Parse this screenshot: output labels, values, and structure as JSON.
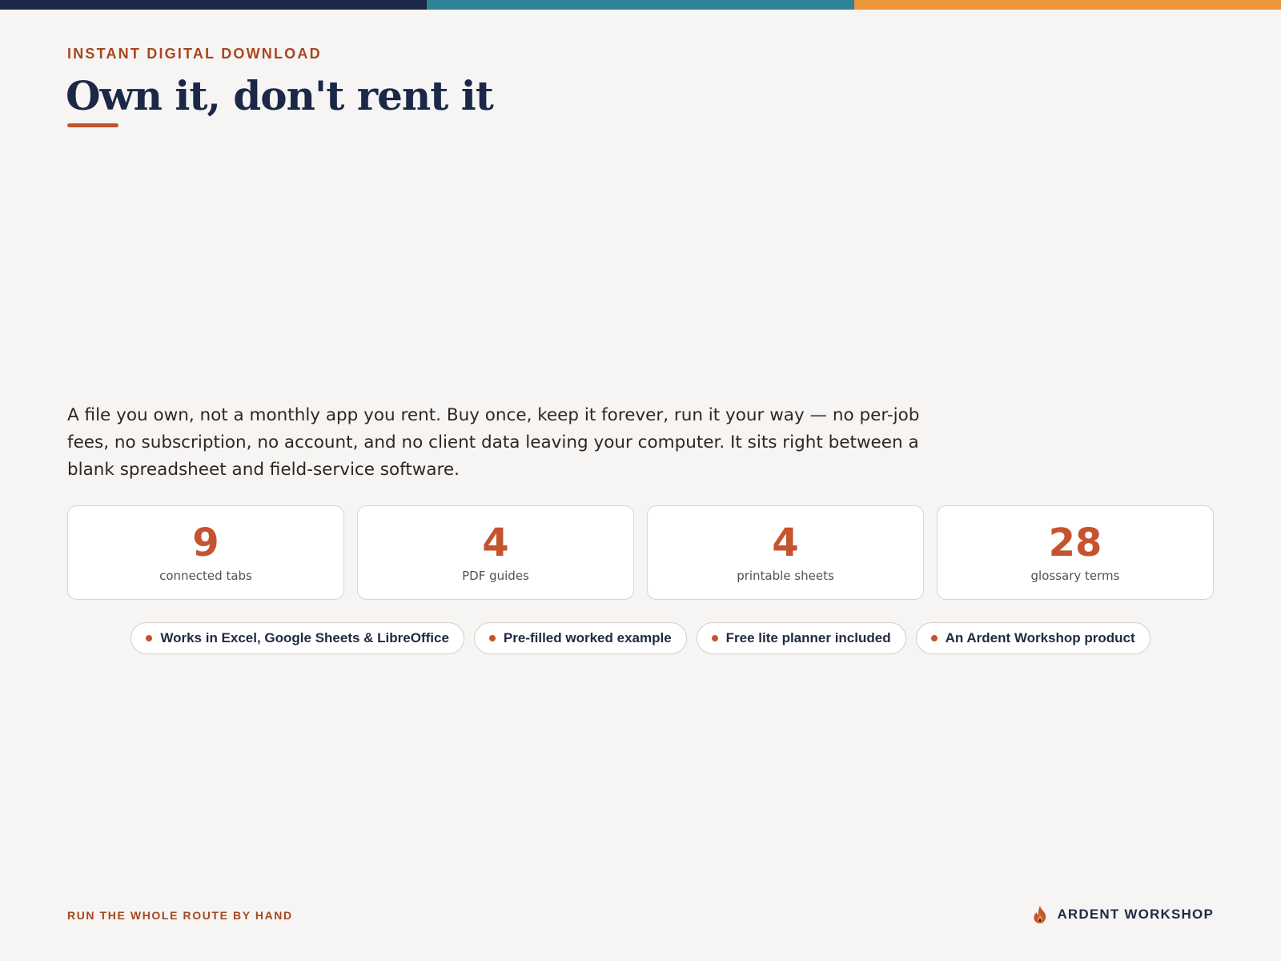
{
  "colors": {
    "navy": "#1c2848",
    "teal": "#2e8494",
    "amber": "#eb963a",
    "accent": "#c5532e",
    "eyebrow": "#a8461f",
    "background": "#f6f5f3"
  },
  "header": {
    "eyebrow": "INSTANT DIGITAL DOWNLOAD",
    "title": "Own it, don't rent it"
  },
  "intro": {
    "text": "A file you own, not a monthly app you rent. Buy once, keep it forever, run it your way — no per-job fees, no subscription, no account, and no client data leaving your computer. It sits right between a blank spreadsheet and field-service software."
  },
  "stats": [
    {
      "value": "9",
      "label": "connected tabs"
    },
    {
      "value": "4",
      "label": "PDF guides"
    },
    {
      "value": "4",
      "label": "printable sheets"
    },
    {
      "value": "28",
      "label": "glossary terms"
    }
  ],
  "pills": [
    {
      "label": "Works in Excel, Google Sheets & LibreOffice"
    },
    {
      "label": "Pre-filled worked example"
    },
    {
      "label": "Free lite planner included"
    },
    {
      "label": "An Ardent Workshop product"
    }
  ],
  "footer": {
    "tagline": "RUN THE WHOLE ROUTE BY HAND",
    "brand": "ARDENT WORKSHOP",
    "brand_icon": "flame-icon"
  }
}
